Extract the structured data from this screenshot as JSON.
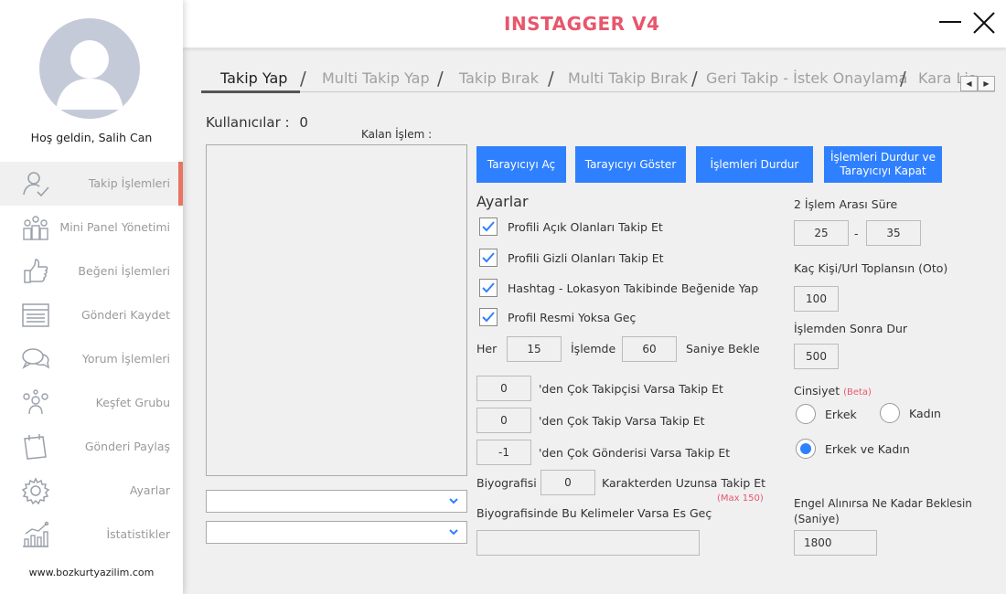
{
  "app": {
    "title": "INSTAGGER V4",
    "accent_color": "#e8566c",
    "button_color": "#2f80ff"
  },
  "sidebar": {
    "welcome": "Hoş geldin, Salih Can",
    "items": [
      {
        "label": "Takip İşlemleri",
        "icon": "user-check-icon",
        "active": true
      },
      {
        "label": "Mini Panel Yönetimi",
        "icon": "group-icon",
        "active": false
      },
      {
        "label": "Beğeni İşlemleri",
        "icon": "thumbs-up-icon",
        "active": false
      },
      {
        "label": "Gönderi Kaydet",
        "icon": "document-icon",
        "active": false
      },
      {
        "label": "Yorum İşlemleri",
        "icon": "chat-icon",
        "active": false
      },
      {
        "label": "Keşfet Grubu",
        "icon": "people-icon",
        "active": false
      },
      {
        "label": "Gönderi Paylaş",
        "icon": "share-post-icon",
        "active": false
      },
      {
        "label": "Ayarlar",
        "icon": "gear-icon",
        "active": false
      },
      {
        "label": "İstatistikler",
        "icon": "stats-icon",
        "active": false
      }
    ],
    "website": "www.bozkurtyazilim.com"
  },
  "tabs": [
    {
      "label": "Takip Yap",
      "active": true
    },
    {
      "label": "Multi Takip Yap",
      "active": false
    },
    {
      "label": "Takip Bırak",
      "active": false
    },
    {
      "label": "Multi Takip Bırak",
      "active": false
    },
    {
      "label": "Geri Takip - İstek Onaylama",
      "active": false
    },
    {
      "label": "Kara Liste",
      "active": false
    }
  ],
  "left_panel": {
    "users_label": "Kullanıcılar :",
    "users_count": "0",
    "remaining_label": "Kalan İşlem :"
  },
  "buttons": {
    "open_browser": "Tarayıcıyı Aç",
    "show_browser": "Tarayıcıyı Göster",
    "stop_actions": "İşlemleri Durdur",
    "stop_and_close": "İşlemleri Durdur ve Tarayıcıyı Kapat"
  },
  "settings": {
    "title": "Ayarlar",
    "checkboxes": [
      {
        "label": "Profili Açık Olanları Takip Et",
        "checked": true
      },
      {
        "label": "Profili Gizli Olanları Takip Et",
        "checked": true
      },
      {
        "label": "Hashtag - Lokasyon Takibinde Beğenide Yap",
        "checked": true
      },
      {
        "label": "Profil Resmi Yoksa Geç",
        "checked": true
      }
    ],
    "every_label": "Her",
    "every_value": "15",
    "in_action_label": "İşlemde",
    "wait_value": "60",
    "wait_label": "Saniye Bekle",
    "follower_threshold": "0",
    "follower_label": "'den Çok Takipçisi Varsa Takip Et",
    "following_threshold": "0",
    "following_label": "'den Çok Takip Varsa Takip Et",
    "posts_threshold": "-1",
    "posts_label": "'den Çok Gönderisi Varsa Takip Et",
    "bio_label": "Biyografisi",
    "bio_value": "0",
    "bio_suffix": "Karakterden Uzunsa Takip Et",
    "bio_max_note": "(Max 150)",
    "bio_keywords_label": "Biyografisinde Bu Kelimeler Varsa Es Geç",
    "bio_keywords_value": ""
  },
  "right_settings": {
    "interval_label": "2 İşlem Arası Süre",
    "interval_min": "25",
    "interval_sep": "-",
    "interval_max": "35",
    "collect_label": "Kaç Kişi/Url Toplansın (Oto)",
    "collect_value": "100",
    "stop_after_label": "İşlemden Sonra Dur",
    "stop_after_value": "500",
    "gender_label": "Cinsiyet",
    "gender_beta": "(Beta)",
    "gender_male": "Erkek",
    "gender_female": "Kadın",
    "gender_both": "Erkek ve Kadın",
    "gender_selected": "both",
    "block_wait_label_1": "Engel Alınırsa Ne Kadar Beklesin",
    "block_wait_label_2": "(Saniye)",
    "block_wait_value": "1800"
  }
}
